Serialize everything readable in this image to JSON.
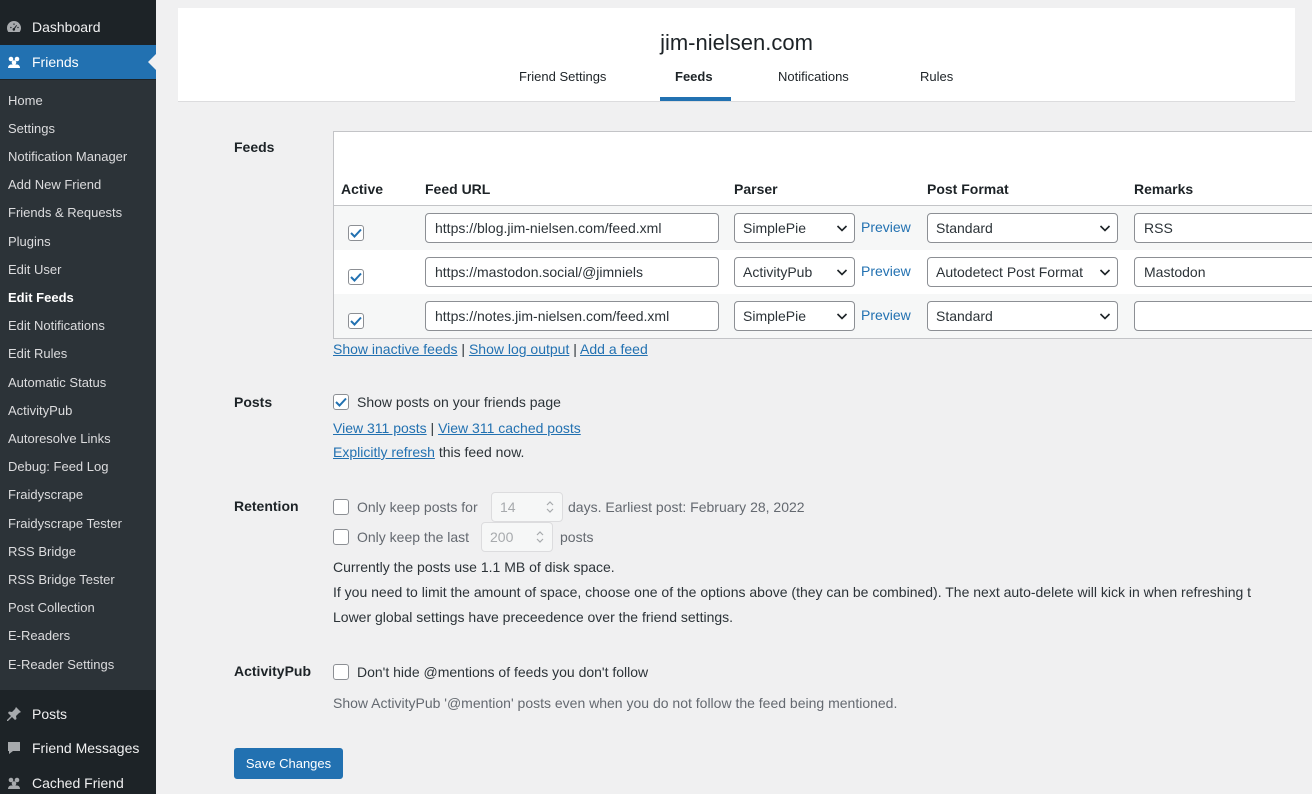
{
  "sidebar": {
    "top_items": [
      {
        "label": "Dashboard",
        "icon": "dashboard-icon"
      },
      {
        "label": "Friends",
        "icon": "friends-icon"
      }
    ],
    "sub_items": [
      "Home",
      "Settings",
      "Notification Manager",
      "Add New Friend",
      "Friends & Requests",
      "Plugins",
      "Edit User",
      "Edit Feeds",
      "Edit Notifications",
      "Edit Rules",
      "Automatic Status",
      "ActivityPub",
      "Autoresolve Links",
      "Debug: Feed Log",
      "Fraidyscrape",
      "Fraidyscrape Tester",
      "RSS Bridge",
      "RSS Bridge Tester",
      "Post Collection",
      "E-Readers",
      "E-Reader Settings"
    ],
    "active_sub_item": "Edit Feeds",
    "bottom_items": [
      {
        "label": "Posts",
        "icon": "pin-icon"
      },
      {
        "label": "Friend Messages",
        "icon": "comment-icon"
      },
      {
        "label": "Cached Friend",
        "icon": "friends-icon"
      }
    ]
  },
  "header": {
    "site_title": "jim-nielsen.com",
    "tabs": [
      "Friend Settings",
      "Feeds",
      "Notifications",
      "Rules"
    ],
    "active_tab": "Feeds"
  },
  "feeds": {
    "label": "Feeds",
    "columns": [
      "Active",
      "Feed URL",
      "Parser",
      "Post Format",
      "Remarks"
    ],
    "rows": [
      {
        "active": true,
        "url": "https://blog.jim-nielsen.com/feed.xml",
        "parser": "SimplePie",
        "preview": "Preview",
        "format": "Standard",
        "remarks": "RSS"
      },
      {
        "active": true,
        "url": "https://mastodon.social/@jimniels",
        "parser": "ActivityPub",
        "preview": "Preview",
        "format": "Autodetect Post Format",
        "remarks": "Mastodon"
      },
      {
        "active": true,
        "url": "https://notes.jim-nielsen.com/feed.xml",
        "parser": "SimplePie",
        "preview": "Preview",
        "format": "Standard",
        "remarks": ""
      }
    ],
    "links": {
      "show_inactive": "Show inactive feeds",
      "show_log": "Show log output",
      "add_feed": "Add a feed",
      "separator": "|"
    }
  },
  "posts": {
    "label": "Posts",
    "show_posts_label": "Show posts on your friends page",
    "show_posts_checked": true,
    "view_posts": "View 311 posts",
    "view_cached": "View 311 cached posts",
    "refresh_link": "Explicitly refresh",
    "refresh_suffix": "this feed now."
  },
  "retention": {
    "label": "Retention",
    "keep_days_prefix": "Only keep posts for",
    "keep_days_value": "14",
    "keep_days_suffix": "days. Earliest post: February 28, 2022",
    "keep_last_prefix": "Only keep the last",
    "keep_last_value": "200",
    "keep_last_suffix": "posts",
    "disk_usage": "Currently the posts use 1.1 MB of disk space.",
    "limit_note": "If you need to limit the amount of space, choose one of the options above (they can be combined). The next auto-delete will kick in when refreshing t",
    "global_note": "Lower global settings have preceedence over the friend settings."
  },
  "activitypub": {
    "label": "ActivityPub",
    "checkbox_label": "Don't hide @mentions of feeds you don't follow",
    "checked": false,
    "description": "Show ActivityPub '@mention' posts even when you do not follow the feed being mentioned."
  },
  "save_button": "Save Changes",
  "colors": {
    "accent": "#2271b1",
    "sidebar_bg": "#1d2327",
    "submenu_bg": "#2c3338",
    "page_bg": "#f0f0f1"
  }
}
